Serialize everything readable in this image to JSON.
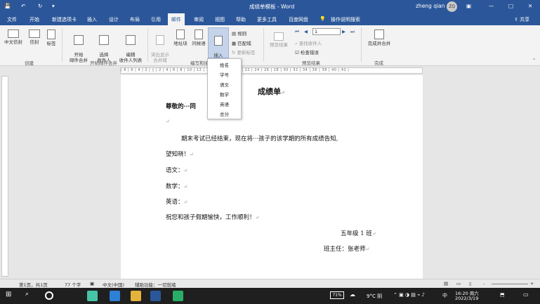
{
  "window": {
    "doc_title": "成绩单模板 - Word",
    "user_name": "zheng qian",
    "user_initials": "ZQ"
  },
  "tabs": [
    "文件",
    "开始",
    "新建选项卡",
    "插入",
    "设计",
    "布局",
    "引用",
    "邮件",
    "审阅",
    "视图",
    "帮助",
    "更多工具",
    "百度网盘",
    "操作说明搜索"
  ],
  "active_tab": "邮件",
  "share_label": "共享",
  "ribbon": {
    "create": {
      "chinese_envelope": "中文信封",
      "envelope": "信封",
      "labels": "标签",
      "group": "创建"
    },
    "start_merge": {
      "start": "开始\n邮件合并",
      "select": "选择\n收件人",
      "edit": "编辑\n收件人列表",
      "group": "开始邮件合并"
    },
    "write_insert": {
      "highlight": "突出显示\n合并域",
      "address": "地址块",
      "greeting": "问候语",
      "insert_field": "插入\n合并域",
      "rules": "规则",
      "match": "匹配域",
      "update": "更新标签",
      "group": "编写和插入域"
    },
    "preview": {
      "preview_btn": "预览结果",
      "record": "1",
      "find": "查找收件人",
      "check": "检查错误",
      "group": "预览结果"
    },
    "finish": {
      "finish_merge": "完成并合并",
      "group": "完成"
    }
  },
  "dropdown": {
    "items": [
      "姓名",
      "学号",
      "语文",
      "数学",
      "英语",
      "总分"
    ]
  },
  "document": {
    "title": "成绩单",
    "greeting": "尊敬的···同",
    "para1": "期末考试已经结束，现在将···孩子的该学期的所有成绩告知,",
    "para1b": "望知晓！",
    "chinese": "语文：",
    "math": "数学：",
    "english": "英语：",
    "wish": "祝您和孩子假期愉快，工作顺利！",
    "class": "五年级 1 班",
    "teacher": "班主任：张老师"
  },
  "status": {
    "page": "第1页，共1页",
    "words": "77 个字",
    "lang": "中文(中国)",
    "access": "辅助功能：一切就绪",
    "zoom": "-"
  },
  "taskbar": {
    "battery": "71%",
    "weather": "9°C 阴",
    "ime": "中",
    "time": "16:20 周六",
    "date": "2022/3/19"
  },
  "colors": {
    "word_blue": "#2b579a",
    "ribbon_bg": "#f3f3f3"
  }
}
